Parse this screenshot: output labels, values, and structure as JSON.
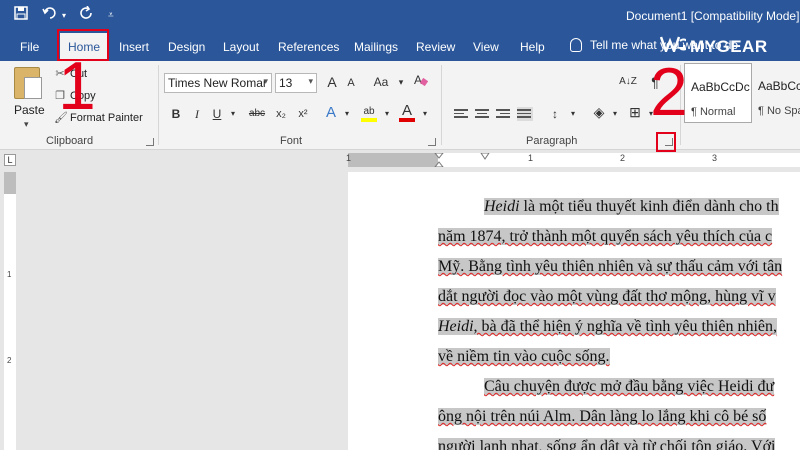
{
  "window": {
    "title": "Document1 [Compatibility Mode]"
  },
  "qat": {
    "save_icon": "save-icon",
    "undo_icon": "undo-icon",
    "redo_icon": "redo-icon",
    "customize_icon": "customize-icon"
  },
  "tabs": [
    {
      "label": "File"
    },
    {
      "label": "Home"
    },
    {
      "label": "Insert"
    },
    {
      "label": "Design"
    },
    {
      "label": "Layout"
    },
    {
      "label": "References"
    },
    {
      "label": "Mailings"
    },
    {
      "label": "Review"
    },
    {
      "label": "View"
    },
    {
      "label": "Help"
    }
  ],
  "tellme": {
    "label": "Tell me what you want to do"
  },
  "logo": {
    "mark": "\\G",
    "word": "MYGEAR"
  },
  "clipboard": {
    "paste": "Paste",
    "cut": "Cut",
    "copy": "Copy",
    "format_painter": "Format Painter",
    "group_label": "Clipboard"
  },
  "font": {
    "family": "Times New Romar",
    "size": "13",
    "group_label": "Font",
    "grow": "A",
    "shrink": "A",
    "case": "Aa",
    "bold": "B",
    "italic": "I",
    "underline": "U",
    "strike": "abc",
    "subscript": "x₂",
    "superscript": "x²",
    "text_effects": "A",
    "highlight": "ab",
    "font_color": "A"
  },
  "paragraph": {
    "group_label": "Paragraph",
    "sort": "A↓Z",
    "pilcrow": "¶"
  },
  "styles": [
    {
      "sample": "AaBbCcDc",
      "name": "¶ Normal"
    },
    {
      "sample": "AaBbCcDc",
      "name": "¶ No Spac"
    }
  ],
  "ruler": {
    "corner": "L",
    "numbers": [
      "1",
      "1",
      "2",
      "3"
    ],
    "vnumbers": [
      "1",
      "2"
    ]
  },
  "document": {
    "lines": [
      {
        "italic": "Heidi",
        "text": " là một tiểu thuyết kinh điển dành cho th",
        "indent": true
      },
      {
        "text": "năm 1874, trở thành một quyển sách yêu thích của c"
      },
      {
        "text": "Mỹ. Bằng tình yêu thiên nhiên và sự thấu cảm với tân"
      },
      {
        "text": "dắt người đọc vào một vùng đất thơ mộng, hùng vĩ v"
      },
      {
        "italic": "Heidi",
        "text": ", bà đã thể hiện ý nghĩa về tình yêu thiên nhiên,"
      },
      {
        "text": "về niềm tin vào cuộc sống."
      },
      {
        "text": "Câu chuyện được mở đầu bằng việc Heidi đư",
        "indent": true
      },
      {
        "text": "ông nội trên núi Alm. Dân làng lo lắng khi cô bé số"
      },
      {
        "text": "người lạnh nhạt, sống ẩn dật và từ chối tôn giáo. Với"
      }
    ]
  },
  "annotations": {
    "step1": "1",
    "step2": "2"
  },
  "colors": {
    "accent": "#2b579a",
    "annotation": "#e3001b",
    "selection": "#c7c7c7"
  }
}
